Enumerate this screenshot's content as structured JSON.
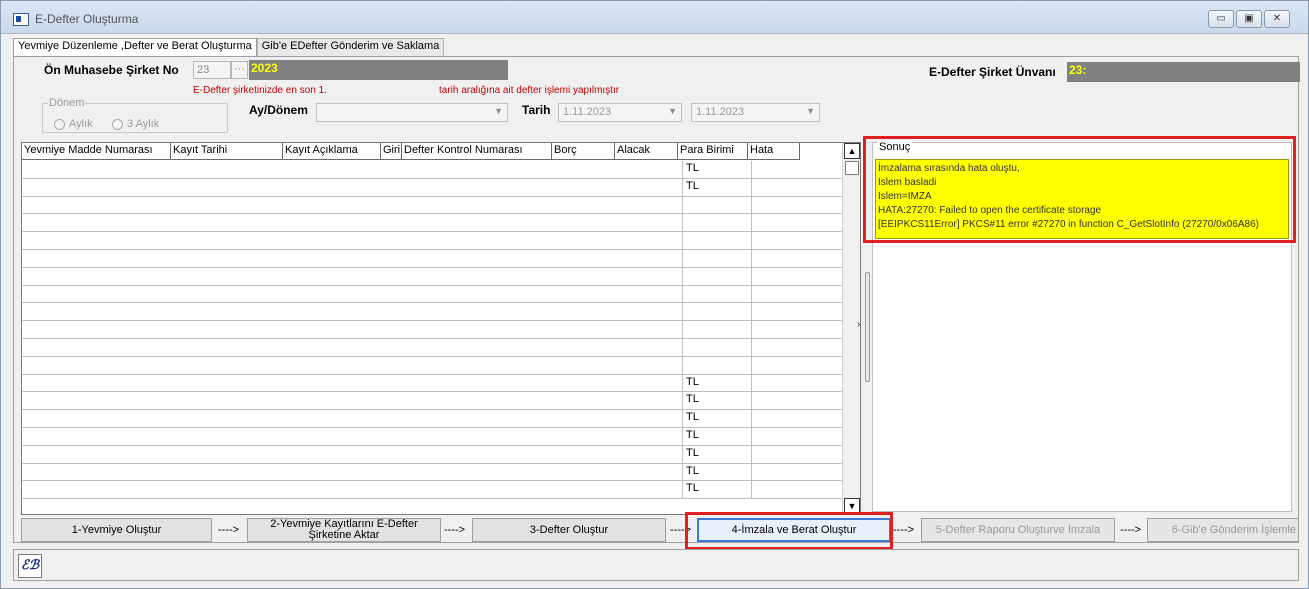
{
  "window": {
    "title": "E-Defter Oluşturma",
    "controls": {
      "minimize": "▭",
      "maximize": "▣",
      "close": "✕"
    }
  },
  "tabs": [
    {
      "label": "Yevmiye Düzenleme ,Defter ve Berat Oluşturma",
      "active": true
    },
    {
      "label": "Gib'e EDefter Gönderim ve Saklama",
      "active": false
    }
  ],
  "form": {
    "company_no_label": "Ön Muhasebe Şirket No",
    "company_no_value": "23",
    "company_no_lookup": "···",
    "company_year": "2023",
    "company_title_label": "E-Defter Şirket Ünvanı",
    "company_title_value": "23:",
    "info_line_1": "E-Defter şirketinizde en son 1.",
    "info_line_2": "tarih aralığına ait defter işlemi yapılmıştır",
    "donem_group_title": "Dönem",
    "radio_monthly": "Aylık",
    "radio_quarterly": "3 Aylık",
    "ay_donem_label": "Ay/Dönem",
    "ay_donem_value": "",
    "tarih_label": "Tarih",
    "date_from": "1.11.2023",
    "date_to": "1.11.2023"
  },
  "grid": {
    "columns": [
      "Yevmiye Madde Numarası",
      "Kayıt Tarihi",
      "Kayıt Açıklama",
      "Giri",
      "Defter Kontrol Numarası",
      "Borç",
      "Alacak",
      "Para Birimi",
      "Hata"
    ],
    "rows": [
      "TL",
      "TL",
      "",
      "",
      "",
      "",
      "",
      "",
      "",
      "",
      "",
      "",
      "TL",
      "TL",
      "TL",
      "TL",
      "TL",
      "TL",
      "TL"
    ]
  },
  "result": {
    "group_title": "Sonuç",
    "lines": [
      "İmzalama sırasında hata oluştu,",
      "Islem basladi",
      "Islem=IMZA",
      "HATA:27270: Failed to open the certificate storage",
      "[EEIPKCS11Error] PKCS#11 error #27270 in function C_GetSlotInfo (27270/0x06A86)"
    ]
  },
  "steps": [
    {
      "label": "1-Yevmiye Oluştur",
      "state": "enabled"
    },
    {
      "label": "2-Yevmiye Kayıtlarını E-Defter Şirketine Aktar",
      "state": "enabled"
    },
    {
      "label": "3-Defter Oluştur",
      "state": "enabled"
    },
    {
      "label": "4-İmzala ve Berat Oluştur",
      "state": "active"
    },
    {
      "label": "5-Defter Raporu Oluşturve İmzala",
      "state": "disabled"
    },
    {
      "label": "6-Gib'e Gönderim İşlemle",
      "state": "disabled"
    }
  ],
  "step_arrow": "---->",
  "status": {
    "logo_text": "ℰℬ"
  },
  "colors": {
    "highlight": "#ffff00",
    "alert_border": "#e02020",
    "info_text": "#c00000"
  }
}
